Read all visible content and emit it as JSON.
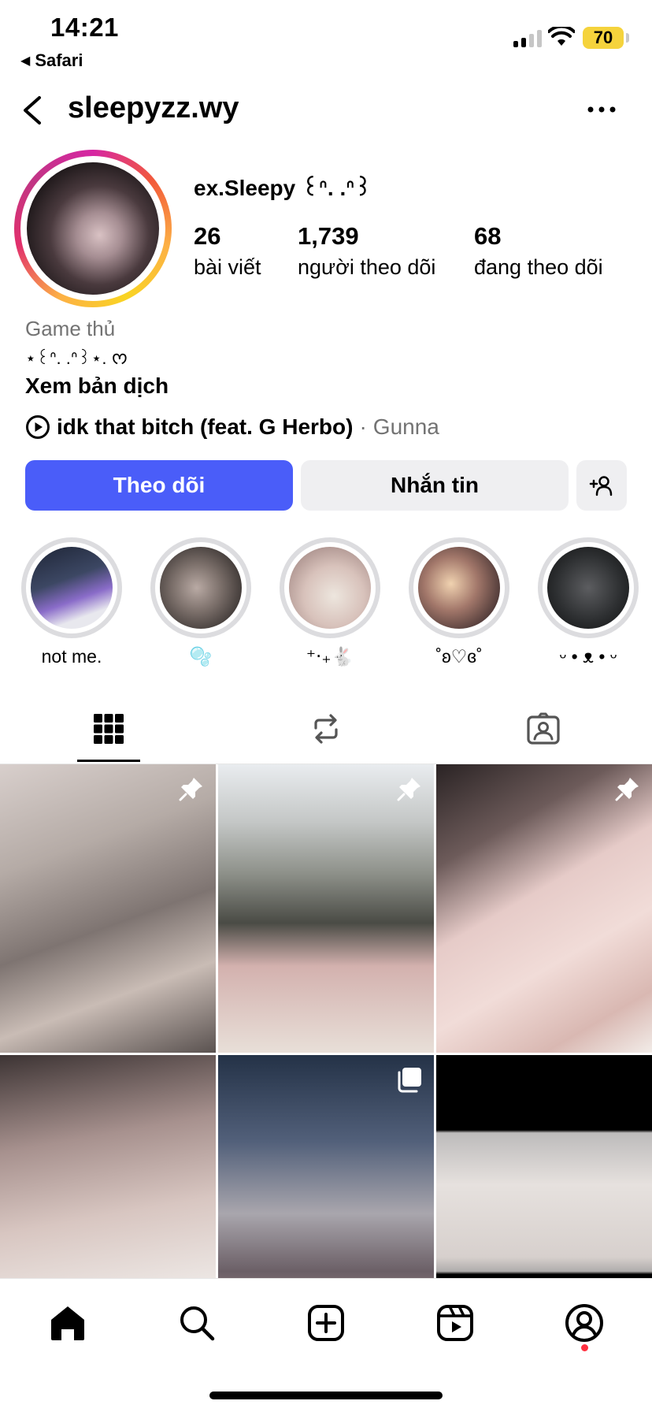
{
  "status_bar": {
    "time": "14:21",
    "back_app": "Safari",
    "battery": "70",
    "battery_color": "#f5d33c"
  },
  "header": {
    "username": "sleepyzz.wy",
    "back_icon": "chevron-left-icon",
    "more_icon": "ellipsis-icon"
  },
  "profile": {
    "display_name": "ex.Sleepy ꒰ᐢ. .ᐢ꒱",
    "stats": [
      {
        "value": "26",
        "label": "bài viết"
      },
      {
        "value": "1,739",
        "label": "người theo dõi"
      },
      {
        "value": "68",
        "label": "đang theo dõi"
      }
    ],
    "category": "Game thủ",
    "bio": "⋆꒰ᐢ. .ᐢ꒱⋆. ᰔ",
    "translate": "Xem bản dịch",
    "music": {
      "song": "idk that bitch (feat. G Herbo)",
      "separator": "·",
      "artist": "Gunna"
    }
  },
  "actions": {
    "follow": "Theo dõi",
    "message": "Nhắn tin",
    "follow_color": "#4a5df9"
  },
  "highlights": [
    {
      "label": "not me."
    },
    {
      "label": "🫧"
    },
    {
      "label": "⁺‧₊🐇"
    },
    {
      "label": "˚ʚ♡ɞ˚"
    },
    {
      "label": "ᵕ • ᴥ • ᵕ"
    }
  ],
  "tabs": [
    {
      "name": "grid-icon",
      "active": true
    },
    {
      "name": "repost-icon",
      "active": false
    },
    {
      "name": "tagged-icon",
      "active": false
    }
  ],
  "posts": [
    {
      "pinned": true,
      "multi": false
    },
    {
      "pinned": true,
      "multi": false
    },
    {
      "pinned": true,
      "multi": false
    },
    {
      "pinned": false,
      "multi": false
    },
    {
      "pinned": false,
      "multi": true
    },
    {
      "pinned": false,
      "multi": false
    }
  ],
  "bottom_nav": [
    "home-icon",
    "search-icon",
    "create-icon",
    "reels-icon",
    "profile-icon"
  ]
}
